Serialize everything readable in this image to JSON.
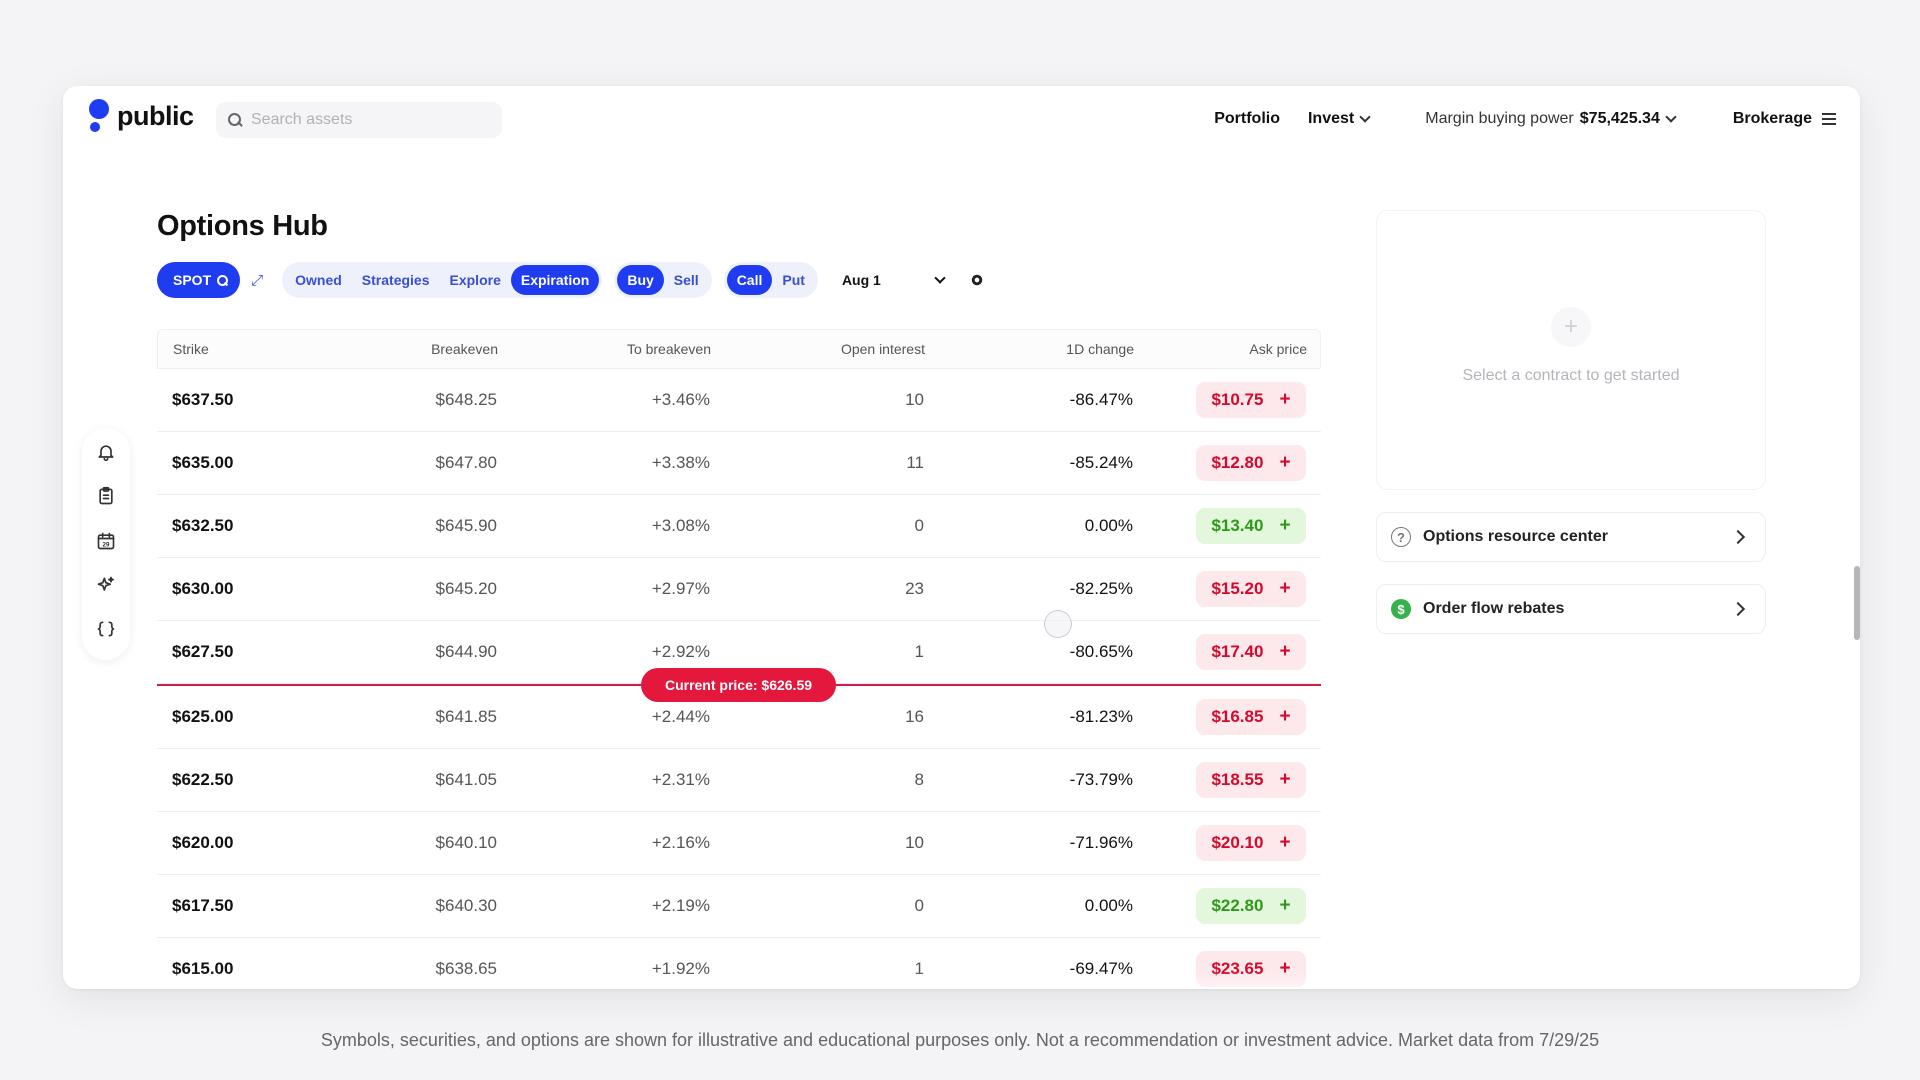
{
  "header": {
    "logo_text": "public",
    "search_placeholder": "Search assets",
    "nav": {
      "portfolio": "Portfolio",
      "invest": "Invest",
      "margin_label": "Margin buying power",
      "margin_value": "$75,425.34",
      "brokerage": "Brokerage"
    }
  },
  "rail": {
    "items": [
      "bell-icon",
      "clipboard-icon",
      "calendar-icon",
      "sparkle-icon",
      "code-braces-icon"
    ],
    "calendar_day": "29"
  },
  "page": {
    "title": "Options Hub"
  },
  "filters": {
    "symbol": "SPOT",
    "views": [
      {
        "label": "Owned",
        "active": false
      },
      {
        "label": "Strategies",
        "active": false
      },
      {
        "label": "Explore",
        "active": false
      },
      {
        "label": "Expiration",
        "active": true
      }
    ],
    "side": [
      {
        "label": "Buy",
        "active": true
      },
      {
        "label": "Sell",
        "active": false
      }
    ],
    "type": [
      {
        "label": "Call",
        "active": true
      },
      {
        "label": "Put",
        "active": false
      }
    ],
    "expiration": "Aug 1"
  },
  "table": {
    "columns": [
      "Strike",
      "Breakeven",
      "To breakeven",
      "Open interest",
      "1D change",
      "Ask price"
    ],
    "rows_above": [
      {
        "strike": "$637.50",
        "breakeven": "$648.25",
        "to_breakeven": "+3.46%",
        "open_interest": "10",
        "change": "-86.47%",
        "ask": "$10.75",
        "tone": "red"
      },
      {
        "strike": "$635.00",
        "breakeven": "$647.80",
        "to_breakeven": "+3.38%",
        "open_interest": "11",
        "change": "-85.24%",
        "ask": "$12.80",
        "tone": "red"
      },
      {
        "strike": "$632.50",
        "breakeven": "$645.90",
        "to_breakeven": "+3.08%",
        "open_interest": "0",
        "change": "0.00%",
        "ask": "$13.40",
        "tone": "green"
      },
      {
        "strike": "$630.00",
        "breakeven": "$645.20",
        "to_breakeven": "+2.97%",
        "open_interest": "23",
        "change": "-82.25%",
        "ask": "$15.20",
        "tone": "red"
      },
      {
        "strike": "$627.50",
        "breakeven": "$644.90",
        "to_breakeven": "+2.92%",
        "open_interest": "1",
        "change": "-80.65%",
        "ask": "$17.40",
        "tone": "red"
      }
    ],
    "current_price": "Current price: $626.59",
    "rows_below": [
      {
        "strike": "$625.00",
        "breakeven": "$641.85",
        "to_breakeven": "+2.44%",
        "open_interest": "16",
        "change": "-81.23%",
        "ask": "$16.85",
        "tone": "red"
      },
      {
        "strike": "$622.50",
        "breakeven": "$641.05",
        "to_breakeven": "+2.31%",
        "open_interest": "8",
        "change": "-73.79%",
        "ask": "$18.55",
        "tone": "red"
      },
      {
        "strike": "$620.00",
        "breakeven": "$640.10",
        "to_breakeven": "+2.16%",
        "open_interest": "10",
        "change": "-71.96%",
        "ask": "$20.10",
        "tone": "red"
      },
      {
        "strike": "$617.50",
        "breakeven": "$640.30",
        "to_breakeven": "+2.19%",
        "open_interest": "0",
        "change": "0.00%",
        "ask": "$22.80",
        "tone": "green"
      },
      {
        "strike": "$615.00",
        "breakeven": "$638.65",
        "to_breakeven": "+1.92%",
        "open_interest": "1",
        "change": "-69.47%",
        "ask": "$23.65",
        "tone": "red"
      }
    ]
  },
  "right_panel": {
    "empty_message": "Select a contract to get started",
    "resource_center": "Options resource center",
    "order_flow": "Order flow rebates"
  },
  "colors": {
    "brand_blue": "#1f3cf0",
    "negative_red": "#d40a2c",
    "positive_green": "#2f9a1a",
    "price_line": "#e4173d"
  },
  "disclaimer": "Symbols, securities, and options are shown for illustrative and educational purposes only. Not a recommendation or investment advice. Market data from 7/29/25"
}
